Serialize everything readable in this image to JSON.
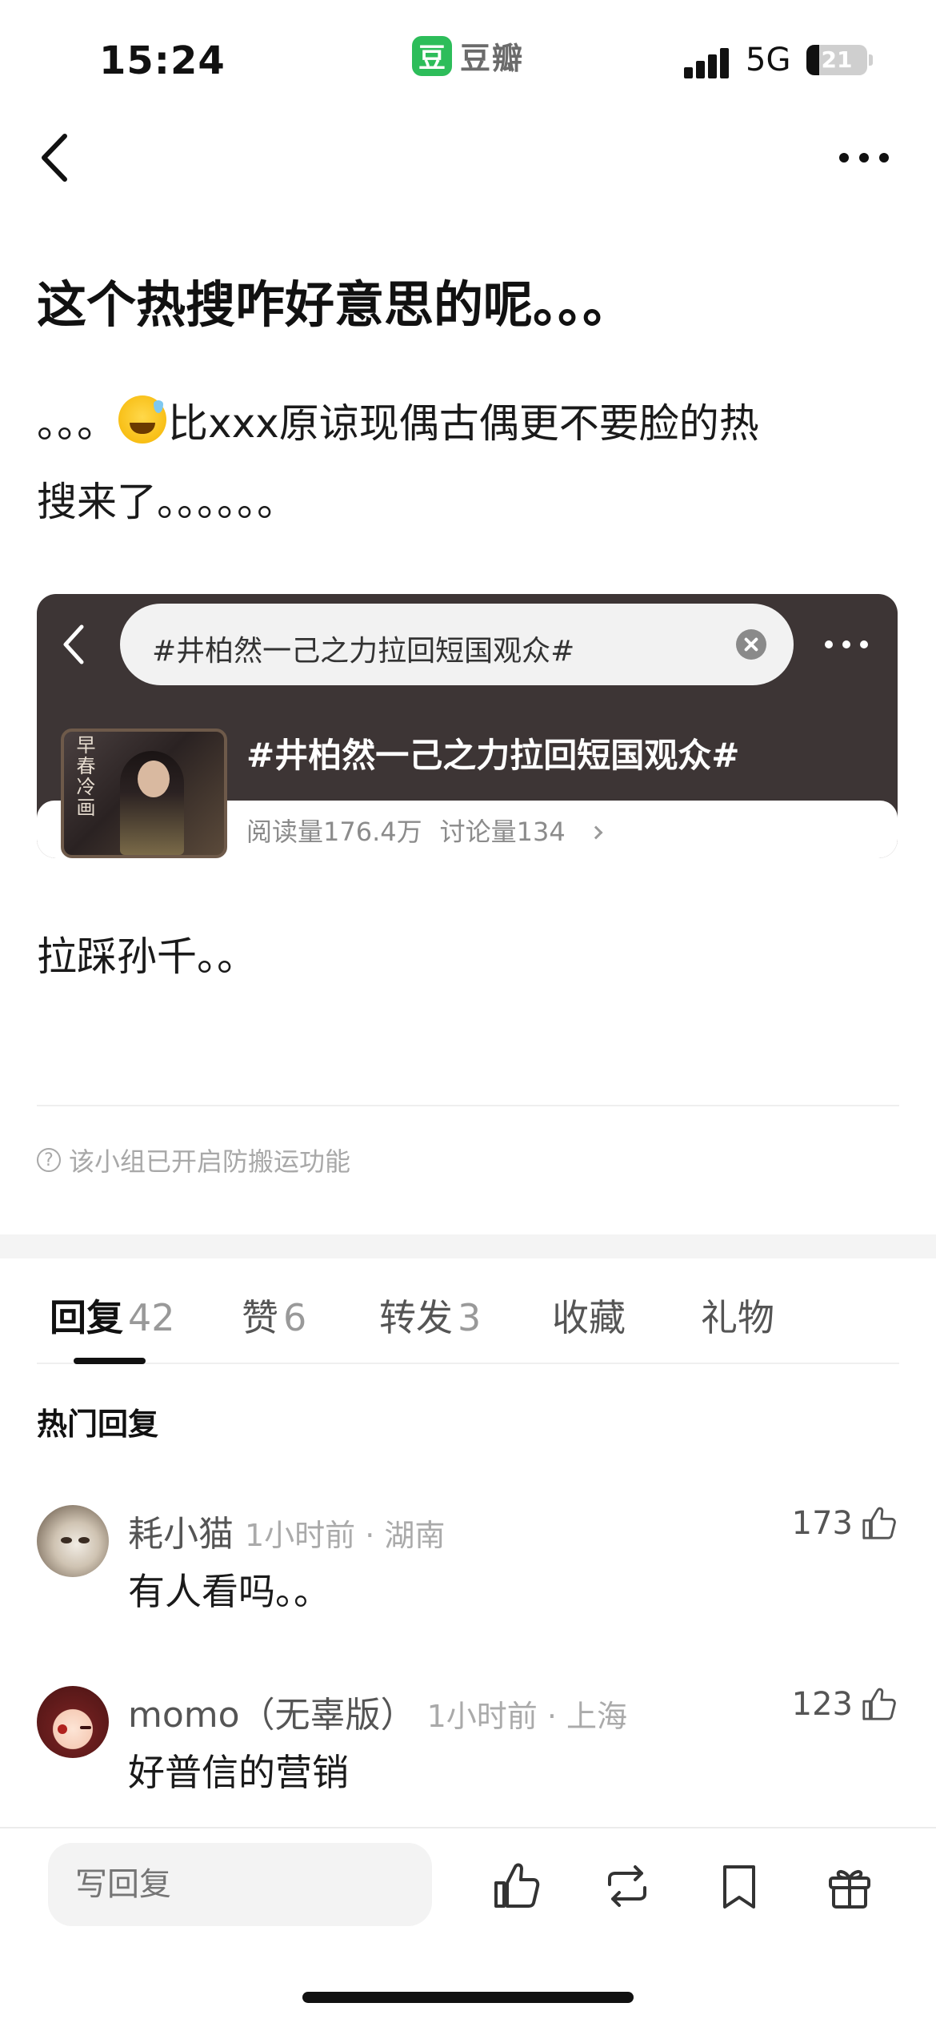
{
  "status_bar": {
    "time": "15:24",
    "app_logo_glyph": "豆",
    "app_name": "豆瓣",
    "network": "5G",
    "battery": "21",
    "battery_fraction": 0.21
  },
  "nav": {
    "back_icon": "chevron-left-icon",
    "more_icon": "more-horizontal-icon"
  },
  "post": {
    "title": "这个热搜咋好意思的呢。。。",
    "body_line1_prefix": "。。。",
    "body_emoji": "grinning-face-with-sweat-emoji",
    "body_line1_suffix": "比xxx原谅现偶古偶更不要脸的热",
    "body_line2": "搜来了。。。。。。",
    "tail": "拉踩孙千。。"
  },
  "embed": {
    "search_text": "#井柏然一己之力拉回短国观众#",
    "thumb_caption": "早春冷画",
    "topic": "#井柏然一己之力拉回短国观众#",
    "reads": "阅读量176.4万",
    "discussions": "讨论量134"
  },
  "notice": {
    "icon": "question-circle-icon",
    "text": "该小组已开启防搬运功能"
  },
  "tabs": [
    {
      "label": "回复",
      "count": "42",
      "active": true
    },
    {
      "label": "赞",
      "count": "6",
      "active": false
    },
    {
      "label": "转发",
      "count": "3",
      "active": false
    },
    {
      "label": "收藏",
      "count": "",
      "active": false
    },
    {
      "label": "礼物",
      "count": "",
      "active": false
    }
  ],
  "hot_replies_title": "热门回复",
  "comments": [
    {
      "name": "耗小猫",
      "meta": "1小时前 · 湖南",
      "likes": "173",
      "text": "有人看吗。。"
    },
    {
      "name": "momo（无辜版）",
      "meta": "1小时前 · 上海",
      "likes": "123",
      "text": "好普信的营销"
    }
  ],
  "bottom_bar": {
    "reply_placeholder": "写回复",
    "icons": [
      "thumbs-up-icon",
      "repost-icon",
      "bookmark-icon",
      "gift-icon"
    ]
  },
  "colors": {
    "brand_green": "#2dbd5a",
    "embed_dark": "#3d3535",
    "text_muted": "#a8a8a8"
  }
}
